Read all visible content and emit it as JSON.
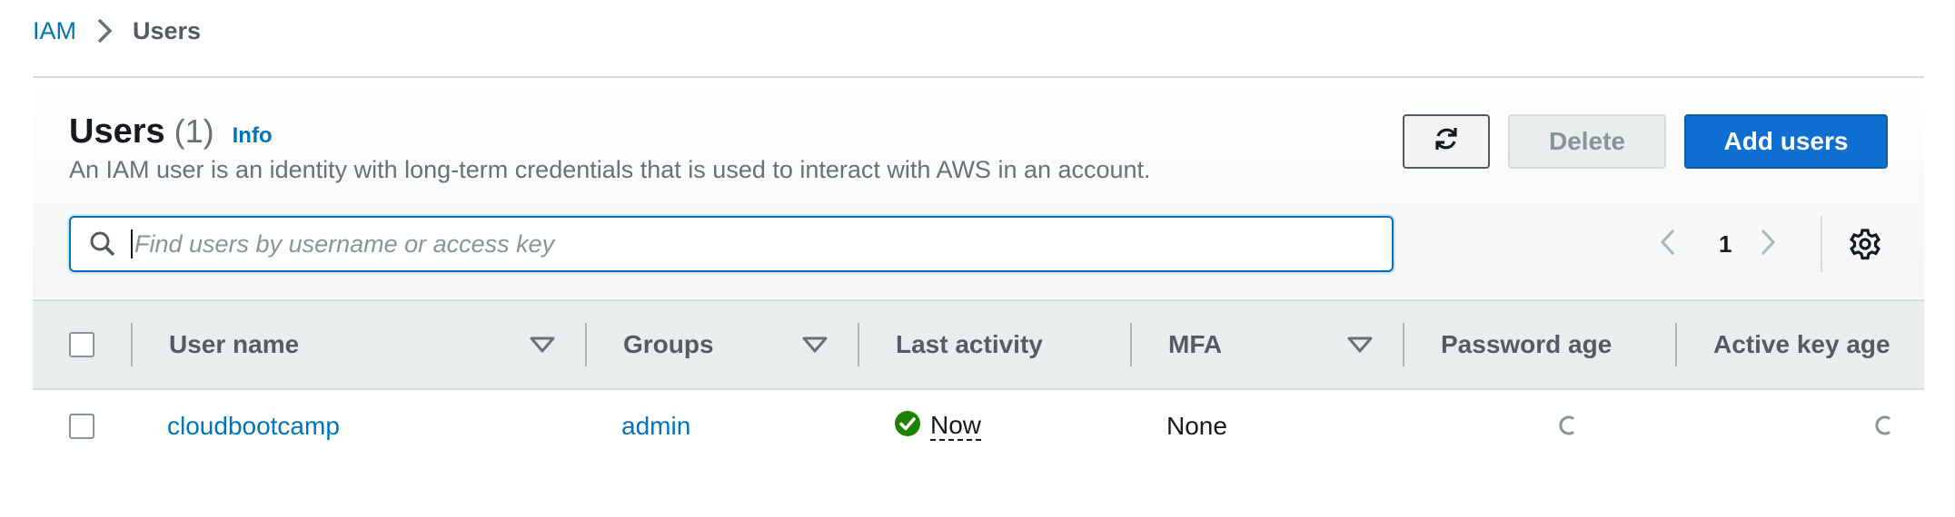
{
  "breadcrumb": {
    "root": "IAM",
    "current": "Users"
  },
  "header": {
    "title": "Users",
    "count": "(1)",
    "info": "Info",
    "description": "An IAM user is an identity with long-term credentials that is used to interact with AWS in an account."
  },
  "actions": {
    "refresh_icon": "refresh-icon",
    "delete_label": "Delete",
    "add_label": "Add users"
  },
  "search": {
    "placeholder": "Find users by username or access key",
    "value": ""
  },
  "pagination": {
    "current_page": "1"
  },
  "table": {
    "columns": [
      {
        "label": "User name",
        "sortable": true
      },
      {
        "label": "Groups",
        "sortable": true
      },
      {
        "label": "Last activity",
        "sortable": false
      },
      {
        "label": "MFA",
        "sortable": true
      },
      {
        "label": "Password age",
        "sortable": false
      },
      {
        "label": "Active key age",
        "sortable": false
      }
    ],
    "rows": [
      {
        "user_name": "cloudbootcamp",
        "groups": "admin",
        "last_activity": "Now",
        "mfa": "None",
        "password_age": "loading",
        "active_key_age": "loading"
      }
    ]
  },
  "colors": {
    "link": "#0073bb",
    "primary_button": "#0f6fd1",
    "success": "#1d8102"
  }
}
